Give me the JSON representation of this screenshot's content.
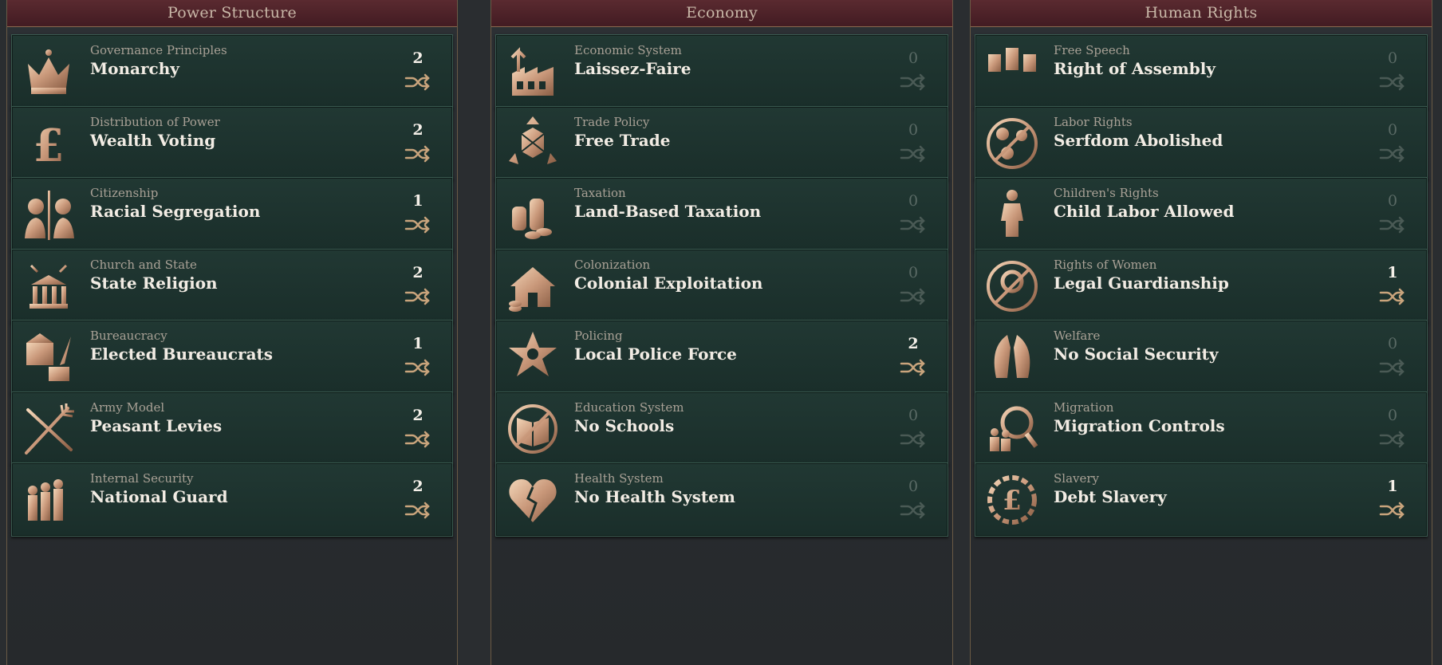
{
  "columns": [
    {
      "title": "Power Structure",
      "laws": [
        {
          "category": "Governance Principles",
          "name": "Monarchy",
          "count": "2",
          "icon": "crown-icon"
        },
        {
          "category": "Distribution of Power",
          "name": "Wealth Voting",
          "count": "2",
          "icon": "pound-sign-icon"
        },
        {
          "category": "Citizenship",
          "name": "Racial Segregation",
          "count": "1",
          "icon": "segregated-profiles-icon"
        },
        {
          "category": "Church and State",
          "name": "State Religion",
          "count": "2",
          "icon": "temple-rays-icon"
        },
        {
          "category": "Bureaucracy",
          "name": "Elected Bureaucrats",
          "count": "1",
          "icon": "ballot-box-quill-icon"
        },
        {
          "category": "Army Model",
          "name": "Peasant Levies",
          "count": "2",
          "icon": "pitchfork-musket-icon"
        },
        {
          "category": "Internal Security",
          "name": "National Guard",
          "count": "2",
          "icon": "soldiers-icon"
        }
      ]
    },
    {
      "title": "Economy",
      "laws": [
        {
          "category": "Economic System",
          "name": "Laissez-Faire",
          "count": "0",
          "icon": "factory-arrow-icon"
        },
        {
          "category": "Trade Policy",
          "name": "Free Trade",
          "count": "0",
          "icon": "crate-arrows-icon"
        },
        {
          "category": "Taxation",
          "name": "Land-Based Taxation",
          "count": "0",
          "icon": "coin-stacks-icon"
        },
        {
          "category": "Colonization",
          "name": "Colonial Exploitation",
          "count": "0",
          "icon": "house-coins-icon"
        },
        {
          "category": "Policing",
          "name": "Local Police Force",
          "count": "2",
          "icon": "sheriff-star-icon"
        },
        {
          "category": "Education System",
          "name": "No Schools",
          "count": "0",
          "icon": "crossed-book-icon"
        },
        {
          "category": "Health System",
          "name": "No Health System",
          "count": "0",
          "icon": "broken-heart-icon"
        }
      ]
    },
    {
      "title": "Human Rights",
      "laws": [
        {
          "category": "Free Speech",
          "name": "Right of Assembly",
          "count": "0",
          "icon": "placards-icon"
        },
        {
          "category": "Labor Rights",
          "name": "Serfdom Abolished",
          "count": "0",
          "icon": "broken-chain-circle-icon"
        },
        {
          "category": "Children's Rights",
          "name": "Child Labor Allowed",
          "count": "0",
          "icon": "child-figure-icon"
        },
        {
          "category": "Rights of Women",
          "name": "Legal Guardianship",
          "count": "1",
          "icon": "crossed-venus-icon"
        },
        {
          "category": "Welfare",
          "name": "No Social Security",
          "count": "0",
          "icon": "praying-hands-icon"
        },
        {
          "category": "Migration",
          "name": "Migration Controls",
          "count": "0",
          "icon": "magnifier-migrants-icon"
        },
        {
          "category": "Slavery",
          "name": "Debt Slavery",
          "count": "1",
          "icon": "chained-pound-icon"
        }
      ]
    }
  ],
  "colors": {
    "accent": "#d9b48f",
    "swap_active": "#c9a47c",
    "swap_inactive": "#4a5a55"
  }
}
